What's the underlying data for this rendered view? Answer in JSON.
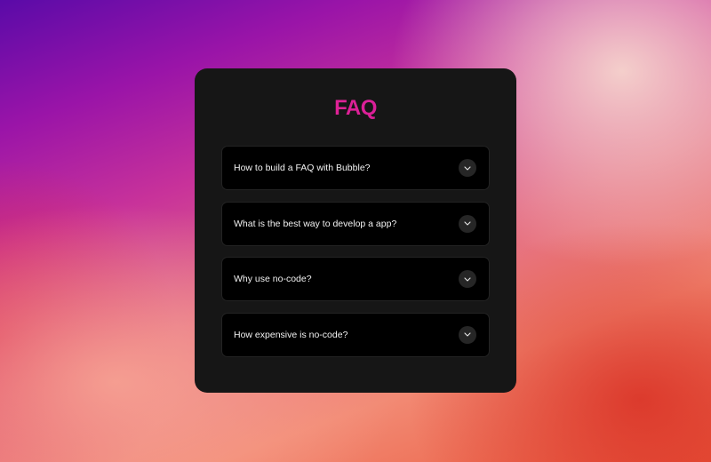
{
  "header": {
    "title": "FAQ"
  },
  "faq": {
    "items": [
      {
        "question": "How to build a FAQ with Bubble?",
        "icon": "chevron-down-icon"
      },
      {
        "question": "What is the best way to develop a app?",
        "icon": "chevron-down-icon"
      },
      {
        "question": "Why use no-code?",
        "icon": "chevron-down-icon"
      },
      {
        "question": "How expensive is no-code?",
        "icon": "chevron-down-icon"
      }
    ]
  },
  "colors": {
    "card_background": "#161616",
    "item_background": "#000000",
    "title_gradient_start": "#ff3b7a",
    "title_gradient_end": "#b8189a"
  }
}
